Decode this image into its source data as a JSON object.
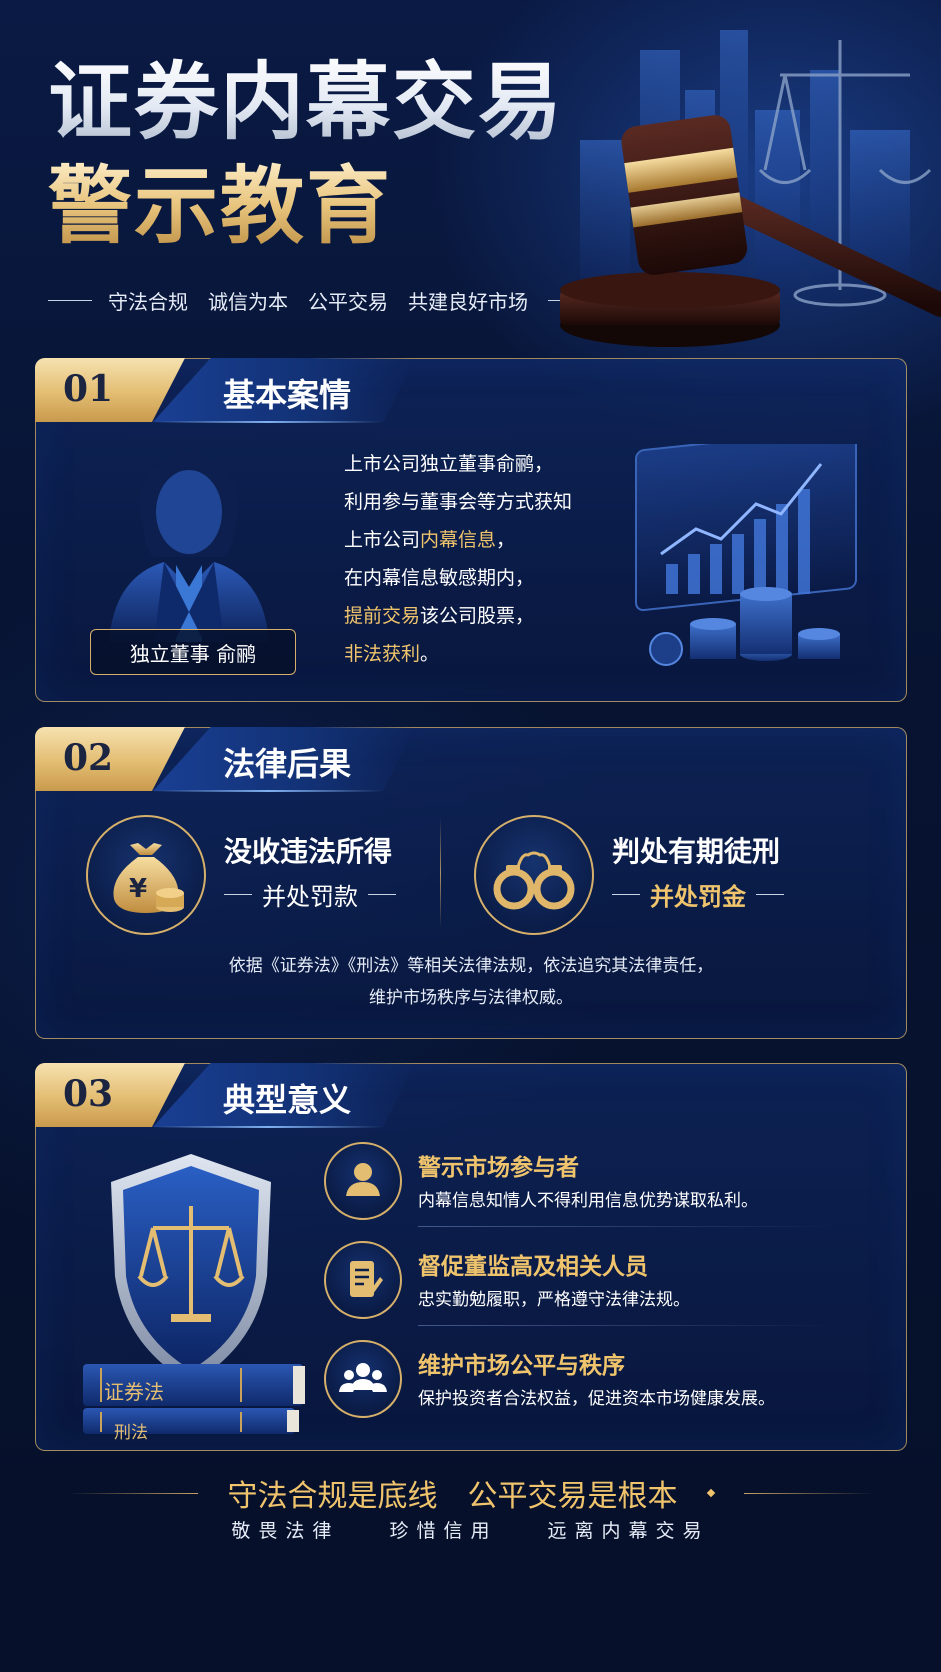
{
  "hero": {
    "title_line1": "证券内幕交易",
    "title_line2": "警示教育",
    "slogans": [
      "守法合规",
      "诚信为本",
      "公平交易",
      "共建良好市场"
    ]
  },
  "section1": {
    "number": "01",
    "title": "基本案情",
    "person_label": "独立董事 俞鹂",
    "lines": [
      {
        "pre": "上市公司独立董事俞鹂，",
        "hl": "",
        "post": ""
      },
      {
        "pre": "利用参与董事会等方式获知",
        "hl": "",
        "post": ""
      },
      {
        "pre": "上市公司",
        "hl": "内幕信息",
        "post": "，"
      },
      {
        "pre": "在内幕信息敏感期内，",
        "hl": "",
        "post": ""
      },
      {
        "pre": "",
        "hl": "提前交易",
        "post": "该公司股票，"
      },
      {
        "pre": "",
        "hl": "非法获利",
        "post": "。"
      }
    ]
  },
  "section2": {
    "number": "02",
    "title": "法律后果",
    "left": {
      "main": "没收违法所得",
      "sub": "并处罚款",
      "icon": "money-bag-icon"
    },
    "right": {
      "main": "判处有期徒刑",
      "sub": "并处罚金",
      "icon": "handcuffs-icon"
    },
    "note_line1": "依据《证券法》《刑法》等相关法律法规，依法追究其法律责任，",
    "note_line2": "维护市场秩序与法律权威。"
  },
  "section3": {
    "number": "03",
    "title": "典型意义",
    "book_top": "证券法",
    "book_bottom": "刑法",
    "items": [
      {
        "title": "警示市场参与者",
        "desc": "内幕信息知情人不得利用信息优势谋取私利。",
        "icon": "person-icon"
      },
      {
        "title": "督促董监高及相关人员",
        "desc": "忠实勤勉履职，严格遵守法律法规。",
        "icon": "document-icon"
      },
      {
        "title": "维护市场公平与秩序",
        "desc": "保护投资者合法权益，促进资本市场健康发展。",
        "icon": "group-icon"
      }
    ]
  },
  "footer": {
    "main_left": "守法合规是底线",
    "main_right": "公平交易是根本",
    "sub": [
      "敬畏法律",
      "珍惜信用",
      "远离内幕交易"
    ]
  },
  "colors": {
    "gold": "#f0c46c",
    "navy": "#07122e",
    "accent_blue": "#1a3f93"
  }
}
